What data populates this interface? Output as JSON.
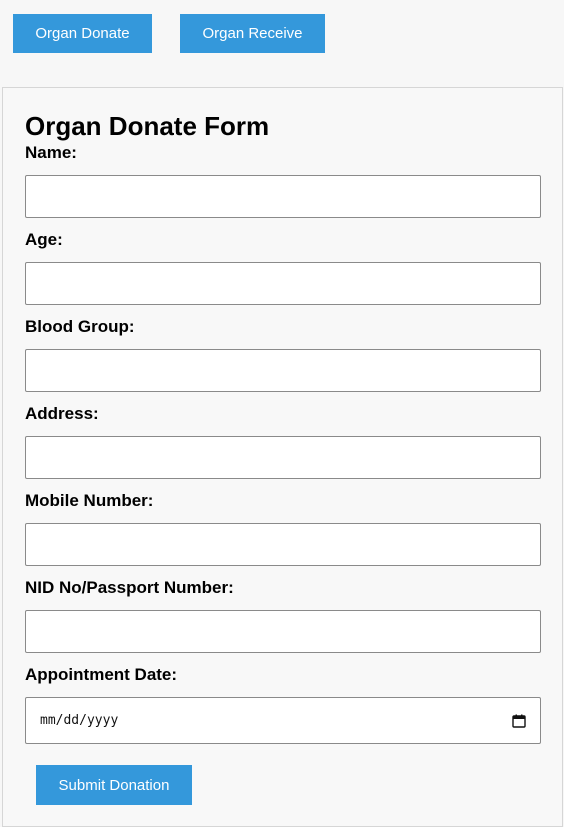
{
  "nav": {
    "donate_label": "Organ Donate",
    "receive_label": "Organ Receive"
  },
  "form": {
    "title": "Organ Donate Form",
    "fields": [
      {
        "label": "Name:",
        "value": ""
      },
      {
        "label": "Age:",
        "value": ""
      },
      {
        "label": "Blood Group:",
        "value": ""
      },
      {
        "label": "Address:",
        "value": ""
      },
      {
        "label": "Mobile Number:",
        "value": ""
      },
      {
        "label": "NID No/Passport Number:",
        "value": ""
      }
    ],
    "appointment": {
      "label": "Appointment Date:",
      "placeholder": "mm/dd/yyyy"
    },
    "submit_label": "Submit Donation"
  },
  "colors": {
    "accent": "#3498db",
    "background": "#f7f7f7"
  },
  "icons": {
    "date_picker": "calendar-icon"
  }
}
